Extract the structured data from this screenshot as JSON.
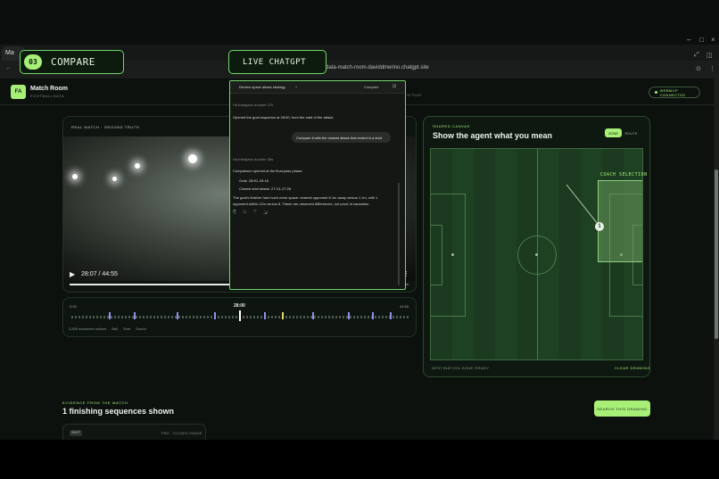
{
  "browser": {
    "tab_label": "Ma",
    "address": "...data-match-room.daviddmerino.chatgpt.site",
    "address_right": "ST PULP"
  },
  "overlay": {
    "compare_step": "03",
    "compare_label": "COMPARE",
    "live_label": "LIVE CHATGPT"
  },
  "app": {
    "logo": "FA",
    "title": "Match Room",
    "subtitle": "FOOTBALLDATA",
    "status": "WEBMCP CONNECTED"
  },
  "video": {
    "tag": "REAL MATCH · GROUND TRUTH",
    "time": "28:07 / 44:55"
  },
  "timeline": {
    "start": "0:00",
    "current": "28:00",
    "end": "44:55",
    "legend": [
      "2,839 advanced actions",
      "Ball",
      "Shot",
      "Sound"
    ]
  },
  "chat": {
    "title": "Review space attack strategy",
    "compare": "Compare",
    "meta1": "Ha trabajado durante 27s",
    "msg1": "Opened the goal sequence at 28:00, from the start of the attack.",
    "user_msg": "Compare it with the closest attack that ended in a shot",
    "meta2": "Ha trabajado durante 38s",
    "msg2": "Comparison opened at the final-pass phase:",
    "bullet1": "Goal: 28:00–28:16",
    "bullet2": "Closest shot attack: 27:13–27:26",
    "msg3": "The goal's finisher had much more space: nearest opponent 8.1m away versus 1.1m, with 1 opponent within 12m versus 8. These are observed differences, not proof of causation."
  },
  "canvas": {
    "eyebrow": "SHARED CANVAS",
    "title": "Show the agent what you mean",
    "mode_zone": "ZONE",
    "mode_route": "ROUTE",
    "coach_label": "COACH SELECTION",
    "player_number": "1",
    "footer_left": "DESTINATION ZONE READY",
    "footer_right": "CLEAR DRAWING"
  },
  "evidence": {
    "eyebrow": "EVIDENCE FROM THE MATCH",
    "title": "1 finishing sequences shown",
    "button": "SEARCH THIS DRAWING",
    "card_tag": "SHOT",
    "card_meta": "PRG · CLOSED RANGE"
  },
  "colors": {
    "accent": "#a7ef76",
    "panel_border": "#223224",
    "pitch_dark": "#1b3a1f",
    "pitch_light": "#1f4123"
  }
}
